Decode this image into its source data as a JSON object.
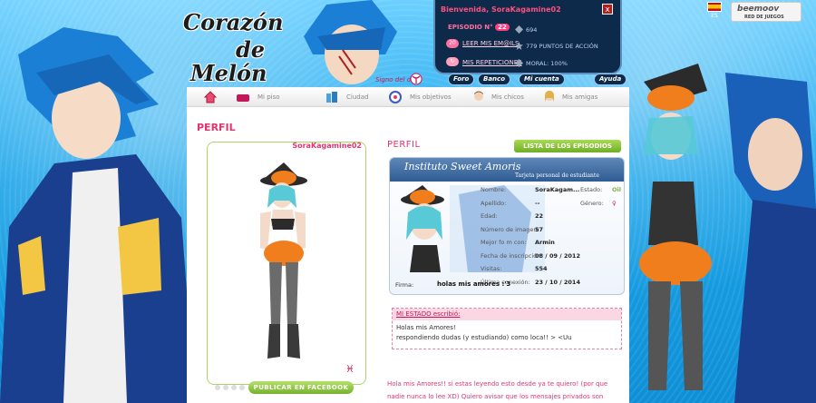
{
  "logo": {
    "line1": "Corazón",
    "line2": "de",
    "line3": "Melón"
  },
  "sign": {
    "label": "Signo del día :"
  },
  "user_panel": {
    "welcome": "Bienvenida, SoraKagamine02",
    "close_label": "x",
    "episode_label": "EPISODIO N°",
    "episode_number": "22",
    "mail_label": "LEER MIS EM@ILS",
    "mail_count": "20",
    "repeats_label": "MIS REPETICIONES",
    "stat_coins": "694",
    "stat_action": "779 PUNTOS DE ACCIÓN",
    "stat_moral": "MORAL: 100%",
    "buttons": {
      "forum": "Foro",
      "banks": "Banco",
      "account": "Mi cuenta",
      "help": "Ayuda"
    }
  },
  "language": {
    "code": "ES"
  },
  "beemoov": {
    "name": "beemoov",
    "sub": "RED DE JUEGOS"
  },
  "nav": {
    "items": [
      {
        "label": "",
        "icon": "home-icon"
      },
      {
        "label": "Mi piso",
        "icon": "sofa-icon"
      },
      {
        "label": "Ciudad",
        "icon": "city-icon"
      },
      {
        "label": "Mis objetivos",
        "icon": "target-icon"
      },
      {
        "label": "Mis chicos",
        "icon": "boy-icon"
      },
      {
        "label": "Mis amigas",
        "icon": "girl-icon"
      }
    ]
  },
  "page": {
    "title": "PERFIL"
  },
  "avatar": {
    "username": "SoraKagamine02",
    "zodiac_icon": "pisces-icon",
    "facebook_button": "PUBLICAR EN FACEBOOK"
  },
  "profile": {
    "title": "PERFIL",
    "episodes_button": "LISTA DE LOS EPISODIOS",
    "card": {
      "school": "Instituto Sweet Amoris",
      "subtitle": "Tarjeta personal de estudiante",
      "rows": [
        {
          "label": "Nombre:",
          "value": "SoraKagam...",
          "extra_label": "Estado:",
          "extra_value": "Oil"
        },
        {
          "label": "Apellido:",
          "value": "--",
          "extra_label": "Género:",
          "extra_value": ""
        },
        {
          "label": "Edad:",
          "value": "22",
          "extra_label": "",
          "extra_value": ""
        },
        {
          "label": "Número de imagen:",
          "value": "57",
          "extra_label": "",
          "extra_value": ""
        },
        {
          "label": "Mejor fo m con:",
          "value": "Armin",
          "extra_label": "",
          "extra_value": ""
        },
        {
          "label": "Fecha de inscripción:",
          "value": "08 / 09 / 2012",
          "extra_label": "",
          "extra_value": ""
        },
        {
          "label": "Visitas:",
          "value": "554",
          "extra_label": "",
          "extra_value": ""
        },
        {
          "label": "Última conexión:",
          "value": "23 / 10 / 2014",
          "extra_label": "",
          "extra_value": ""
        }
      ],
      "signature_label": "Firma:",
      "signature_value": "holas mis amores :'3"
    },
    "status": {
      "label": "MI ESTADO escribió:",
      "line1": "Holas mis Amores!",
      "line2": "respondiendo dudas (y estudiando) como loca!! > <Uu"
    },
    "bio": {
      "line1": "Hola mis Amores!! si estas leyendo esto desde ya te quiero! (por que",
      "line2": "nadie nunca lo lee XD) Quiero avisar que los mensajes privados son"
    }
  },
  "colors": {
    "accent_pink": "#e8336c",
    "green": "#7cb342",
    "navy_panel": "#0e2a4a",
    "sky_blue": "#1aa3e8"
  }
}
